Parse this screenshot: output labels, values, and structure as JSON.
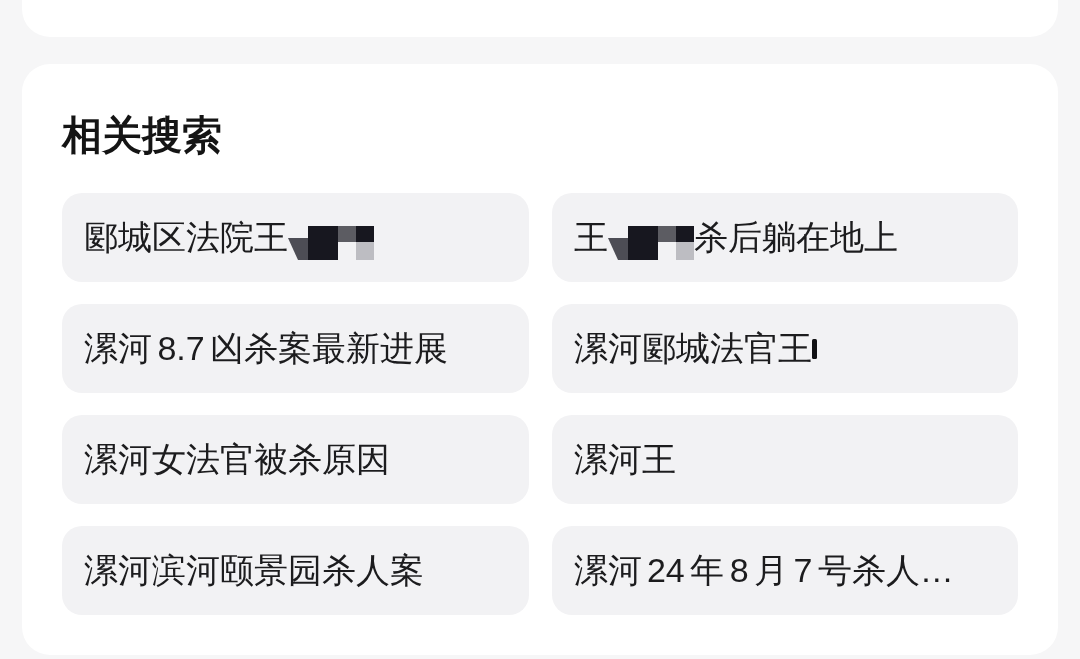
{
  "related_searches": {
    "title": "相关搜索",
    "items": [
      {
        "segments": [
          {
            "kind": "text",
            "text": "郾城区法院王"
          },
          {
            "kind": "pixels"
          }
        ]
      },
      {
        "segments": [
          {
            "kind": "text",
            "text": "王"
          },
          {
            "kind": "pixels"
          },
          {
            "kind": "text",
            "text": "杀后躺在地上"
          }
        ]
      },
      {
        "segments": [
          {
            "kind": "text",
            "text": "漯河 8.7 凶杀案最新进展"
          }
        ]
      },
      {
        "segments": [
          {
            "kind": "text",
            "text": "漯河郾城法官王"
          },
          {
            "kind": "bar"
          }
        ]
      },
      {
        "segments": [
          {
            "kind": "text",
            "text": "漯河女法官被杀原因"
          }
        ]
      },
      {
        "segments": [
          {
            "kind": "text",
            "text": "漯河王"
          }
        ]
      },
      {
        "segments": [
          {
            "kind": "text",
            "text": "漯河滨河颐景园杀人案"
          }
        ]
      },
      {
        "segments": [
          {
            "kind": "text",
            "text": "漯河 24 年 8 月 7 号杀人…"
          }
        ]
      }
    ]
  }
}
